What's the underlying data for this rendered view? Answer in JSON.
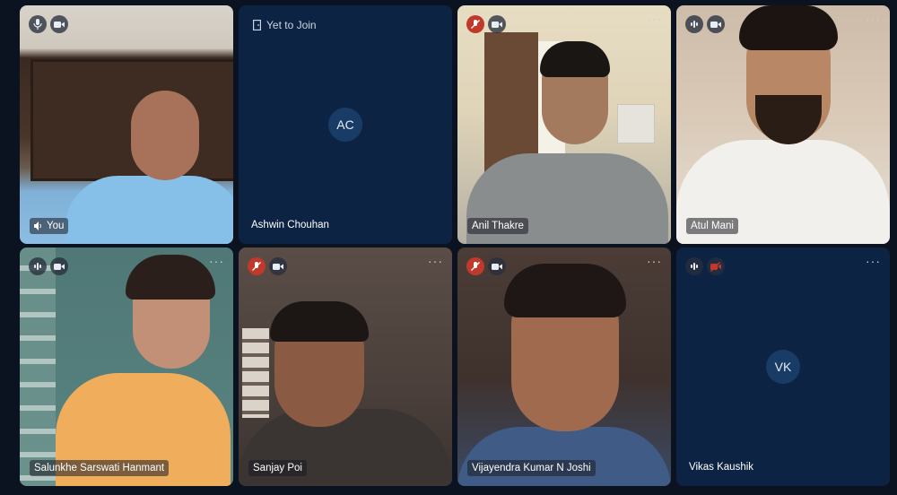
{
  "colors": {
    "background": "#0c1320",
    "tile_dark": "#0d2343",
    "avatar": "#183c66",
    "mic_muted_red": "#c0392b"
  },
  "tiles": [
    {
      "name": "You",
      "speaking": true,
      "mic": "mic-icon",
      "camera": "video-camera-icon"
    },
    {
      "name": "Ashwin Chouhan",
      "initials": "AC",
      "status": "Yet to Join",
      "status_icon": "door-icon"
    },
    {
      "name": "Anil Thakre",
      "mic": "mic-muted-icon",
      "camera": "video-camera-icon",
      "more": "···"
    },
    {
      "name": "Atul Mani",
      "mic": "audio-level-icon",
      "camera": "video-camera-icon",
      "more": "···"
    },
    {
      "name": "Salunkhe Sarswati Hanmant",
      "mic": "audio-level-icon",
      "camera": "video-camera-icon",
      "more": "···"
    },
    {
      "name": "Sanjay Poi",
      "mic": "mic-muted-icon",
      "camera": "video-camera-icon",
      "more": "···"
    },
    {
      "name": "Vijayendra Kumar N Joshi",
      "mic": "mic-muted-icon",
      "camera": "video-camera-icon",
      "more": "···"
    },
    {
      "name": "Vikas Kaushik",
      "initials": "VK",
      "mic": "audio-level-icon",
      "camera": "video-off-icon",
      "more": "···"
    }
  ]
}
